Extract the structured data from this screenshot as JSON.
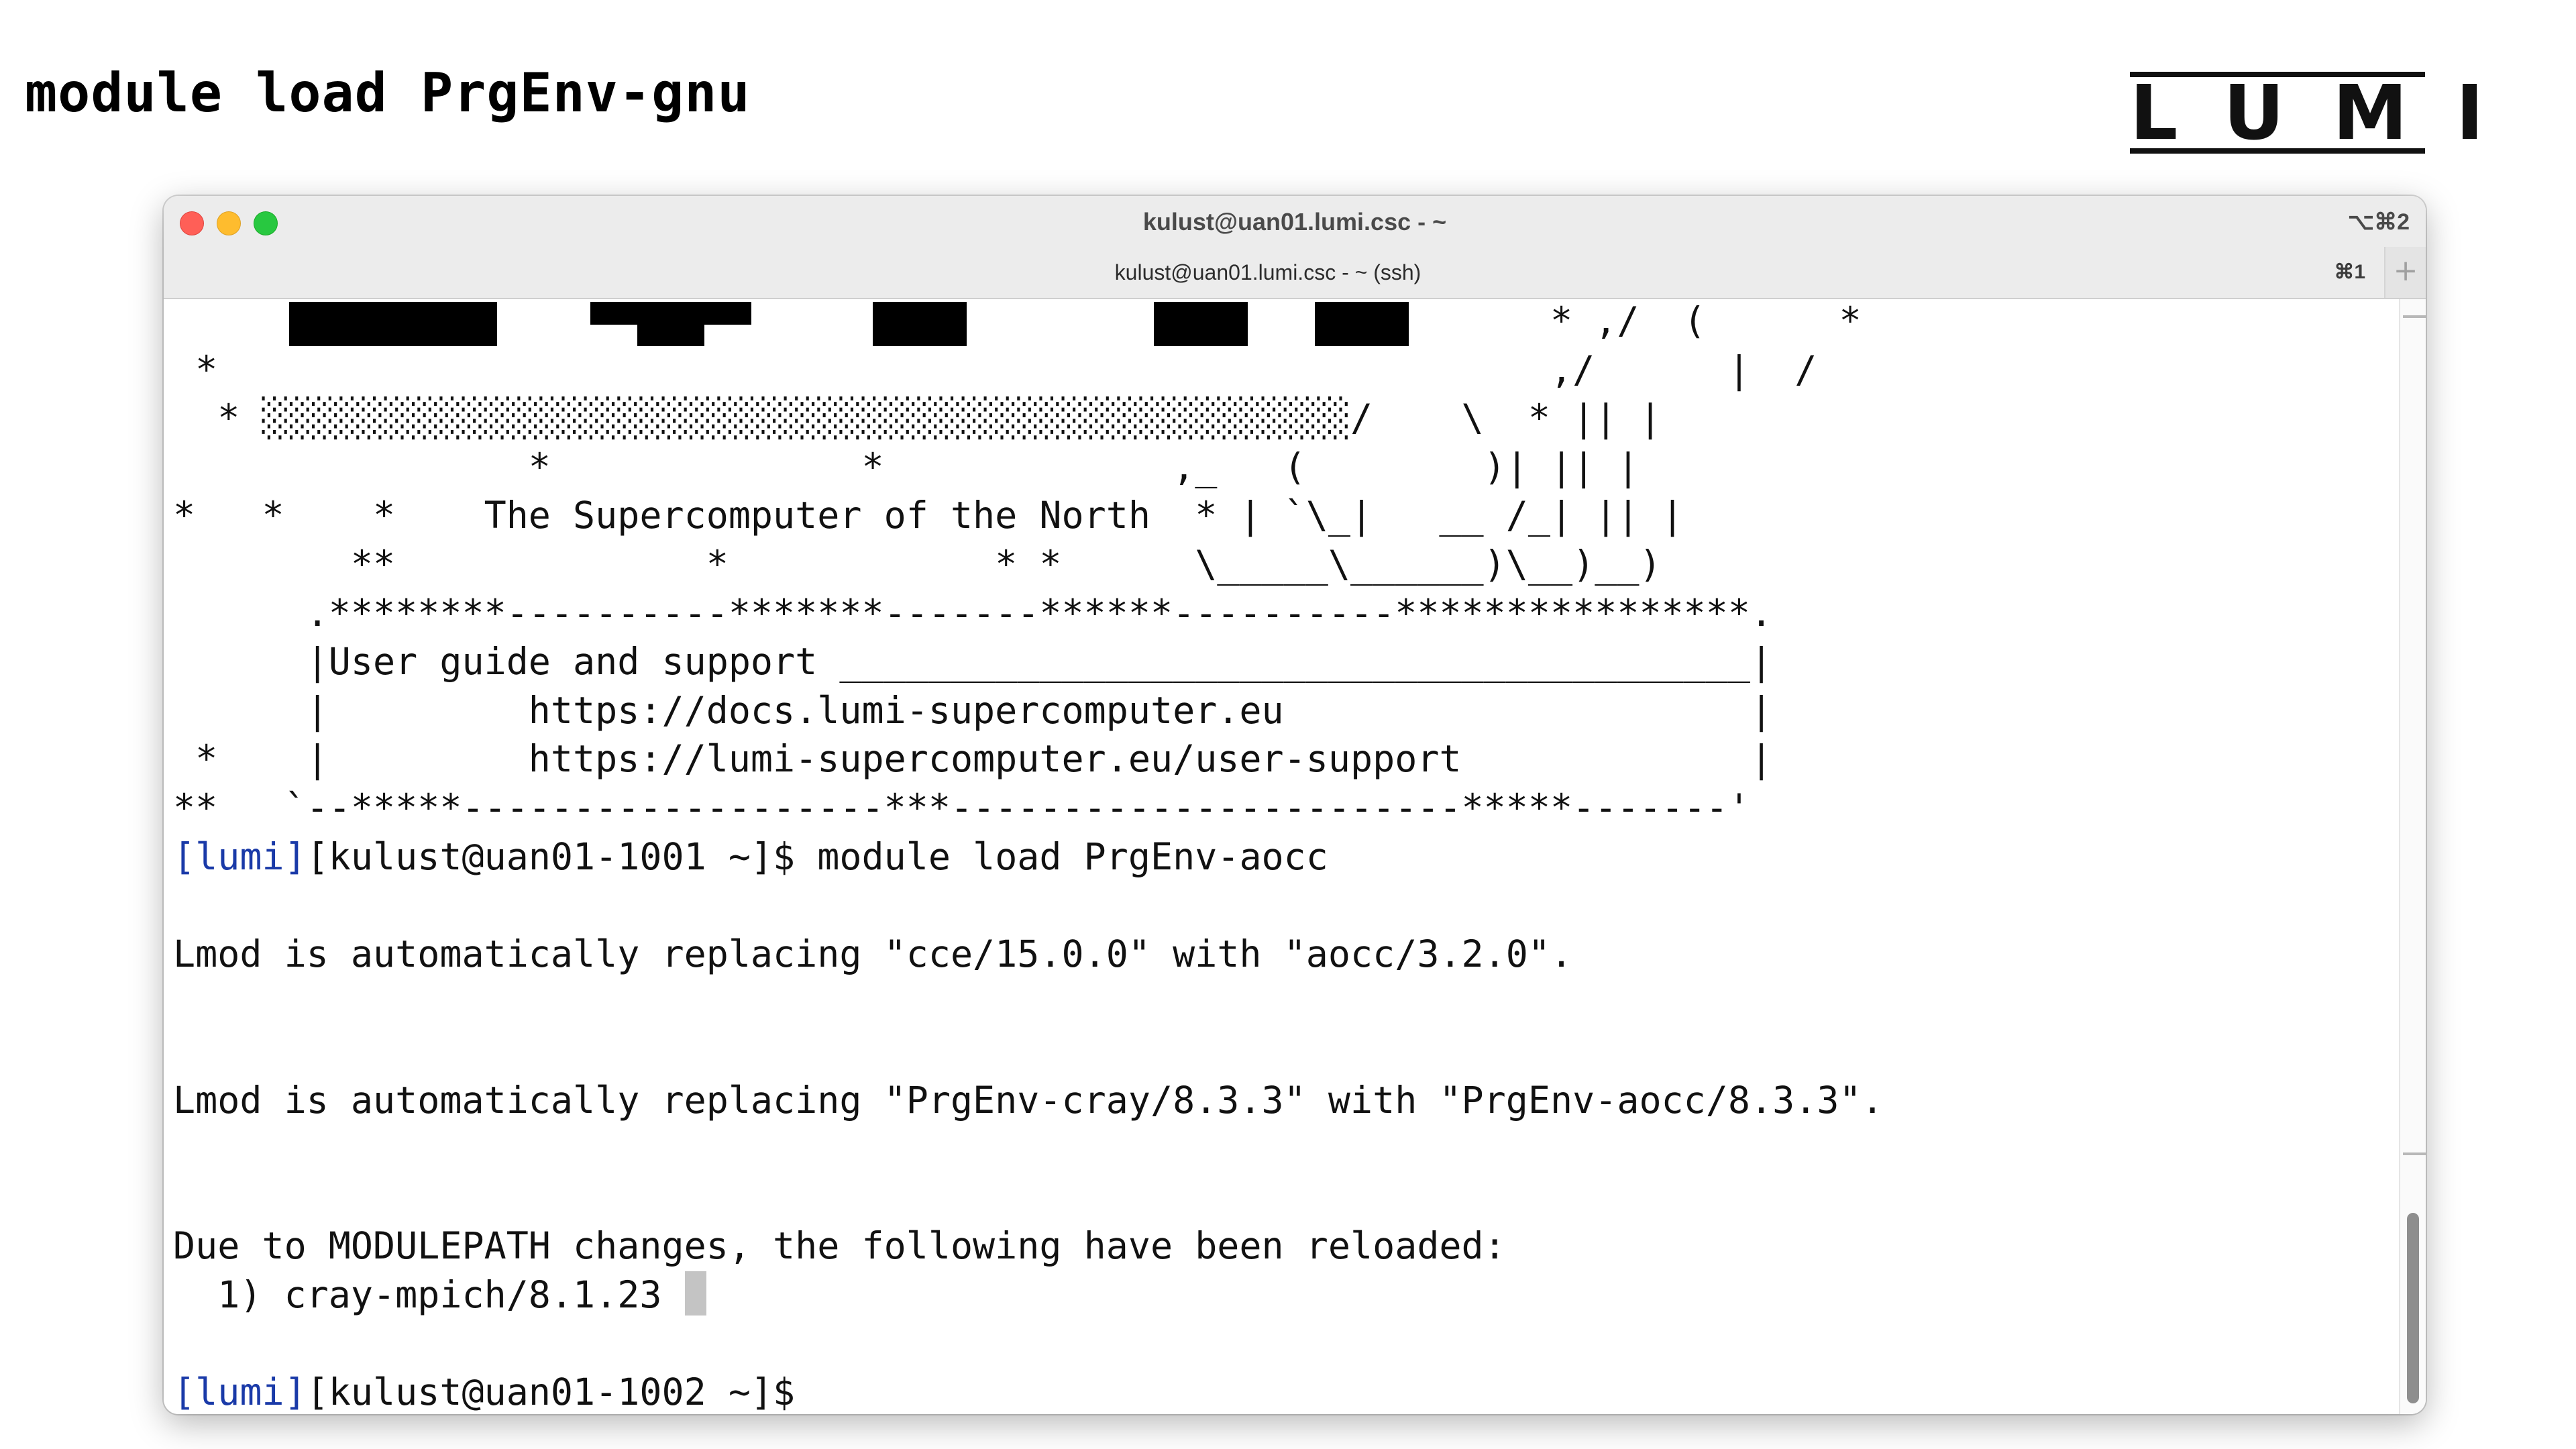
{
  "slide": {
    "title": "module load PrgEnv-gnu",
    "logo_text": "LUMI"
  },
  "window": {
    "title": "kulust@uan01.lumi.csc - ~",
    "shortcut": "⌥⌘2",
    "tab_label": "kulust@uan01.lumi.csc - ~ (ssh)",
    "tab_shortcut": "⌘1",
    "new_tab_symbol": "+",
    "traffic_lights": {
      "close": "#ff5f57",
      "minimize": "#febc2e",
      "maximize": "#28c840"
    }
  },
  "terminal": {
    "prompt_color": "#1a3aa8",
    "banner_lines": [
      "                                                              * ,/  (      *",
      " *                                                            ,/      |  /",
      "  * ░░░░░░░░░░░░░░░░░░░░░░░░░░░░░░░░░░░░░░░░░░░░░░░░░/    \\  * || |",
      "                *              *             ,_   (        )| || |",
      "*   *    *    The Supercomputer of the North  * | `\\_|   __ /_| || |",
      "        **              *            * *      \\_____\\______)\\__)__)",
      "      .********----------*******-------******----------****************.",
      "      |User guide and support _________________________________________|",
      "      |         https://docs.lumi-supercomputer.eu                     |",
      " *    |         https://lumi-supercomputer.eu/user-support             |",
      "**   `--*****-------------------***-----------------------*****-------'"
    ],
    "command1": {
      "tag": "[lumi]",
      "prompt": "[kulust@uan01-1001 ~]$ ",
      "command": "module load PrgEnv-aocc"
    },
    "output": {
      "blank1": "",
      "line1": "Lmod is automatically replacing \"cce/15.0.0\" with \"aocc/3.2.0\".",
      "blank2": "",
      "blank3": "",
      "line2": "Lmod is automatically replacing \"PrgEnv-cray/8.3.3\" with \"PrgEnv-aocc/8.3.3\".",
      "blank4": "",
      "blank5": "",
      "line3": "Due to MODULEPATH changes, the following have been reloaded:",
      "line4": "  1) cray-mpich/8.1.23",
      "blank6": ""
    },
    "command2": {
      "tag": "[lumi]",
      "prompt": "[kulust@uan01-1002 ~]$ ",
      "command": ""
    }
  }
}
